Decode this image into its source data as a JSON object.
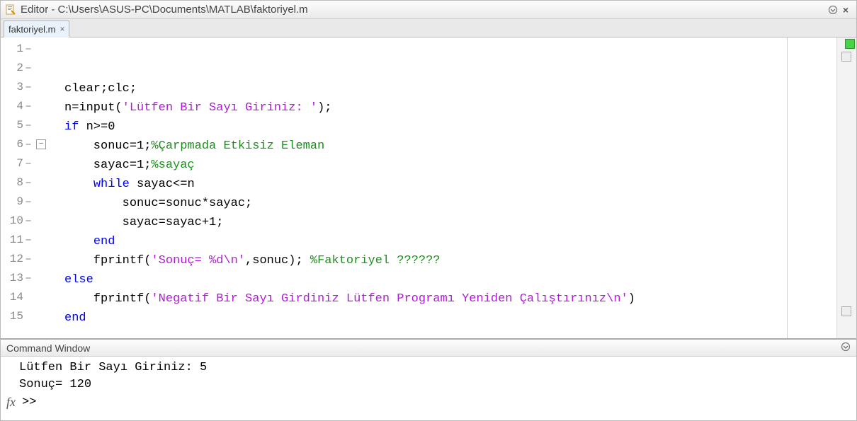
{
  "header": {
    "title": "Editor - C:\\Users\\ASUS-PC\\Documents\\MATLAB\\faktoriyel.m"
  },
  "tabs": [
    {
      "label": "faktoriyel.m"
    }
  ],
  "code": {
    "lines": [
      {
        "n": 1,
        "dash": true,
        "tokens": [
          [
            "txt",
            "clear;clc;"
          ]
        ]
      },
      {
        "n": 2,
        "dash": true,
        "tokens": [
          [
            "txt",
            "n=input("
          ],
          [
            "str",
            "'Lütfen Bir Sayı Giriniz: '"
          ],
          [
            "txt",
            ");"
          ]
        ]
      },
      {
        "n": 3,
        "dash": true,
        "tokens": [
          [
            "kw",
            "if"
          ],
          [
            "txt",
            " n>=0"
          ]
        ]
      },
      {
        "n": 4,
        "dash": true,
        "tokens": [
          [
            "txt",
            "    sonuc=1;"
          ],
          [
            "cm",
            "%Çarpmada Etkisiz Eleman"
          ]
        ]
      },
      {
        "n": 5,
        "dash": true,
        "tokens": [
          [
            "txt",
            "    sayac=1;"
          ],
          [
            "cm",
            "%sayaç"
          ]
        ]
      },
      {
        "n": 6,
        "dash": true,
        "fold": true,
        "tokens": [
          [
            "txt",
            "    "
          ],
          [
            "kw",
            "while"
          ],
          [
            "txt",
            " sayac<=n"
          ]
        ]
      },
      {
        "n": 7,
        "dash": true,
        "tokens": [
          [
            "txt",
            "        sonuc=sonuc*sayac;"
          ]
        ]
      },
      {
        "n": 8,
        "dash": true,
        "tokens": [
          [
            "txt",
            "        sayac=sayac+1;"
          ]
        ]
      },
      {
        "n": 9,
        "dash": true,
        "tokens": [
          [
            "txt",
            "    "
          ],
          [
            "kw",
            "end"
          ]
        ]
      },
      {
        "n": 10,
        "dash": true,
        "tokens": [
          [
            "txt",
            "    fprintf("
          ],
          [
            "str",
            "'Sonuç= %d\\n'"
          ],
          [
            "txt",
            ",sonuc); "
          ],
          [
            "cm",
            "%Faktoriyel ??????"
          ]
        ]
      },
      {
        "n": 11,
        "dash": true,
        "tokens": [
          [
            "kw",
            "else"
          ]
        ]
      },
      {
        "n": 12,
        "dash": true,
        "tokens": [
          [
            "txt",
            "    fprintf("
          ],
          [
            "str",
            "'Negatif Bir Sayı Girdiniz Lütfen Programı Yeniden Çalıştırınız\\n'"
          ],
          [
            "txt",
            ")"
          ]
        ]
      },
      {
        "n": 13,
        "dash": true,
        "tokens": [
          [
            "kw",
            "end"
          ]
        ]
      },
      {
        "n": 14,
        "dash": false,
        "tokens": []
      },
      {
        "n": 15,
        "dash": false,
        "tokens": []
      }
    ]
  },
  "command_window": {
    "title": "Command Window",
    "output": [
      "Lütfen Bir Sayı Giriniz: 5",
      "Sonuç= 120"
    ],
    "prompt": ">>",
    "fx_label": "fx"
  }
}
